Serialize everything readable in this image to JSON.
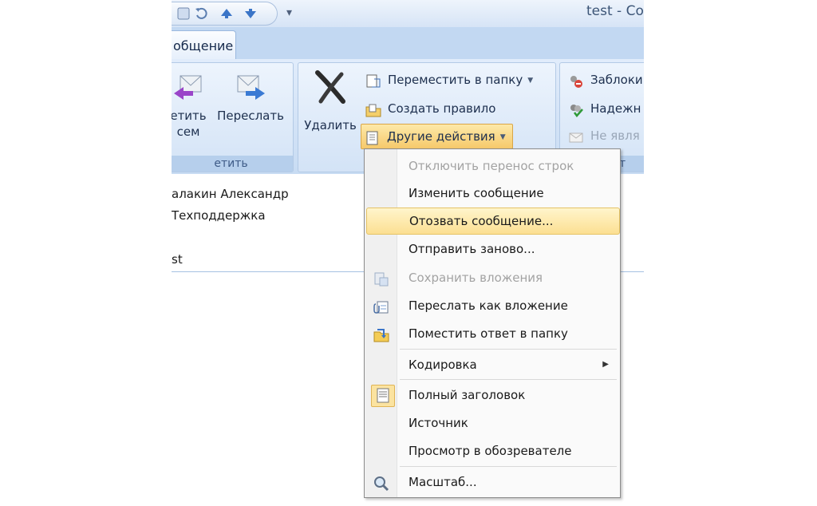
{
  "window": {
    "title": "test - Co"
  },
  "tabs": [
    {
      "label": "общение"
    }
  ],
  "ribbon": {
    "respond_group": {
      "reply_all_label_line1": "етить",
      "reply_all_label_line2": "сем",
      "forward_label": "Переслать",
      "group_label": "етить"
    },
    "actions_group": {
      "delete_label": "Удалить",
      "move_label": "Переместить в папку",
      "create_rule_label": "Создать правило",
      "other_actions_label": "Другие действия"
    },
    "junk_group": {
      "block_label": "Заблоки",
      "safe_label": "Надежн",
      "not_junk_label": "Не явля",
      "group_label": "елат"
    }
  },
  "message": {
    "from": "алакин Александр",
    "to": "Техподдержка",
    "subject": "st"
  },
  "menu": {
    "items": [
      {
        "label": "Отключить перенос строк",
        "disabled": true
      },
      {
        "label": "Изменить сообщение",
        "disabled": false
      },
      {
        "label": "Отозвать сообщение...",
        "disabled": false,
        "highlighted": true
      },
      {
        "label": "Отправить заново...",
        "disabled": false
      },
      {
        "label": "Сохранить вложения",
        "disabled": true,
        "icon": "save-attachments-icon"
      },
      {
        "label": "Переслать как вложение",
        "disabled": false,
        "icon": "forward-attachment-icon"
      },
      {
        "label": "Поместить ответ в папку",
        "disabled": false,
        "icon": "reply-folder-icon"
      },
      {
        "label": "Кодировка",
        "disabled": false,
        "submenu": true
      },
      {
        "label": "Полный заголовок",
        "disabled": false,
        "icon": "header-icon",
        "checked": true
      },
      {
        "label": "Источник",
        "disabled": false
      },
      {
        "label": "Просмотр в обозревателе",
        "disabled": false
      },
      {
        "label": "Масштаб...",
        "disabled": false,
        "icon": "zoom-icon"
      }
    ]
  },
  "colors": {
    "ribbon_bg": "#c8dcf3",
    "highlight": "#fcdf92",
    "text_disabled": "#a3a3a3"
  }
}
